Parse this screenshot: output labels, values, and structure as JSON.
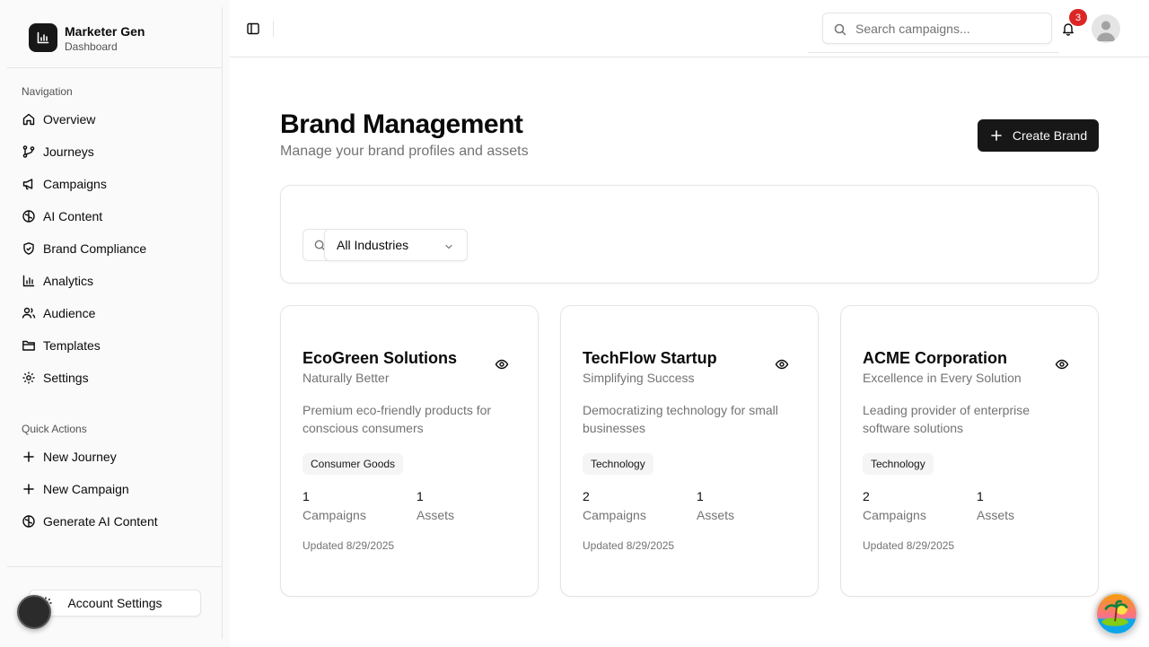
{
  "app": {
    "name": "Marketer Gen",
    "subtitle": "Dashboard"
  },
  "sidebar": {
    "navigation_label": "Navigation",
    "nav_items": [
      {
        "label": "Overview",
        "icon": "home-icon"
      },
      {
        "label": "Journeys",
        "icon": "git-branch-icon"
      },
      {
        "label": "Campaigns",
        "icon": "megaphone-icon"
      },
      {
        "label": "AI Content",
        "icon": "brain-icon"
      },
      {
        "label": "Brand Compliance",
        "icon": "shield-check-icon"
      },
      {
        "label": "Analytics",
        "icon": "bar-chart-icon"
      },
      {
        "label": "Audience",
        "icon": "users-icon"
      },
      {
        "label": "Templates",
        "icon": "folder-icon"
      },
      {
        "label": "Settings",
        "icon": "gear-icon"
      }
    ],
    "quick_actions_label": "Quick Actions",
    "quick_actions": [
      {
        "label": "New Journey",
        "icon": "plus-icon"
      },
      {
        "label": "New Campaign",
        "icon": "plus-icon"
      },
      {
        "label": "Generate AI Content",
        "icon": "brain-icon"
      }
    ],
    "account_settings_label": "Account Settings"
  },
  "topbar": {
    "search_placeholder": "Search campaigns...",
    "notification_count": "3"
  },
  "page": {
    "title": "Brand Management",
    "subtitle": "Manage your brand profiles and assets",
    "create_button_label": "Create Brand",
    "industry_filter_value": "All Industries"
  },
  "brands": [
    {
      "name": "EcoGreen Solutions",
      "tagline": "Naturally Better",
      "description": "Premium eco-friendly products for conscious consumers",
      "industry": "Consumer Goods",
      "campaigns_count": "1",
      "campaigns_label": "Campaigns",
      "assets_count": "1",
      "assets_label": "Assets",
      "updated": "Updated 8/29/2025"
    },
    {
      "name": "TechFlow Startup",
      "tagline": "Simplifying Success",
      "description": "Democratizing technology for small businesses",
      "industry": "Technology",
      "campaigns_count": "2",
      "campaigns_label": "Campaigns",
      "assets_count": "1",
      "assets_label": "Assets",
      "updated": "Updated 8/29/2025"
    },
    {
      "name": "ACME Corporation",
      "tagline": "Excellence in Every Solution",
      "description": "Leading provider of enterprise software solutions",
      "industry": "Technology",
      "campaigns_count": "2",
      "campaigns_label": "Campaigns",
      "assets_count": "1",
      "assets_label": "Assets",
      "updated": "Updated 8/29/2025"
    }
  ],
  "colors": {
    "primary": "#171717",
    "badge": "#dc2626",
    "muted_text": "#737373",
    "border": "#e5e5e5"
  }
}
